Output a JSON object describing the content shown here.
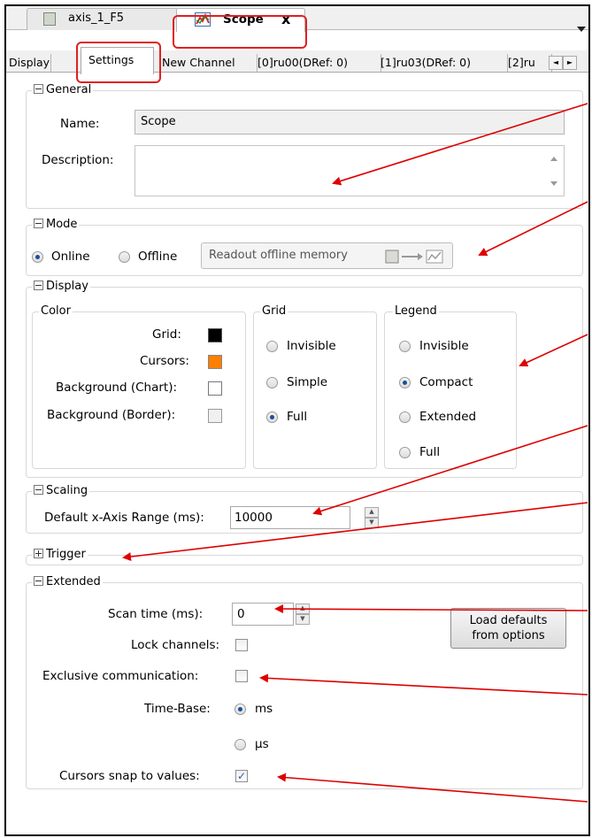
{
  "doc_tabs": [
    {
      "label": "axis_1_F5"
    },
    {
      "label": "Scope",
      "close": "x"
    }
  ],
  "sub_tabs": [
    "Display",
    "Settings",
    "New Channel",
    "[0]ru00(DRef: 0)",
    "[1]ru03(DRef: 0)",
    "[2]ru"
  ],
  "general": {
    "title": "General",
    "name_label": "Name:",
    "name_value": "Scope",
    "description_label": "Description:",
    "description_value": ""
  },
  "mode": {
    "title": "Mode",
    "online_label": "Online",
    "offline_label": "Offline",
    "selected": "Online",
    "readout_button": "Readout offline memory"
  },
  "display": {
    "title": "Display",
    "color": {
      "title": "Color",
      "grid_label": "Grid:",
      "cursors_label": "Cursors:",
      "bg_chart_label": "Background (Chart):",
      "bg_border_label": "Background (Border):",
      "grid_color": "#000000",
      "cursors_color": "#ff7f00",
      "bg_chart_color": "#ffffff",
      "bg_border_color": "#f0f0f0"
    },
    "grid": {
      "title": "Grid",
      "options": [
        "Invisible",
        "Simple",
        "Full"
      ],
      "selected": "Full"
    },
    "legend": {
      "title": "Legend",
      "options": [
        "Invisible",
        "Compact",
        "Extended",
        "Full"
      ],
      "selected": "Compact"
    }
  },
  "scaling": {
    "title": "Scaling",
    "x_range_label": "Default x-Axis Range (ms):",
    "x_range_value": "10000"
  },
  "trigger": {
    "title": "Trigger"
  },
  "extended": {
    "title": "Extended",
    "scan_time_label": "Scan time (ms):",
    "scan_time_value": "0",
    "load_defaults_line1": "Load defaults",
    "load_defaults_line2": "from options",
    "lock_channels_label": "Lock channels:",
    "lock_channels_checked": false,
    "exclusive_comm_label": "Exclusive communication:",
    "exclusive_comm_checked": false,
    "time_base_label": "Time-Base:",
    "time_base_ms": "ms",
    "time_base_us": "µs",
    "time_base_selected": "ms",
    "cursors_snap_label": "Cursors snap to values:",
    "cursors_snap_checked": true,
    "check_mark": "✓"
  },
  "colors": {
    "highlight_red": "#e02020",
    "arrow_red": "#dd0000",
    "radio_dot": "#1a4f9a"
  },
  "icons": [
    "device-icon",
    "scope-icon",
    "dropdown-arrow-icon",
    "scroll-left-icon",
    "scroll-right-icon",
    "readout-icon"
  ]
}
